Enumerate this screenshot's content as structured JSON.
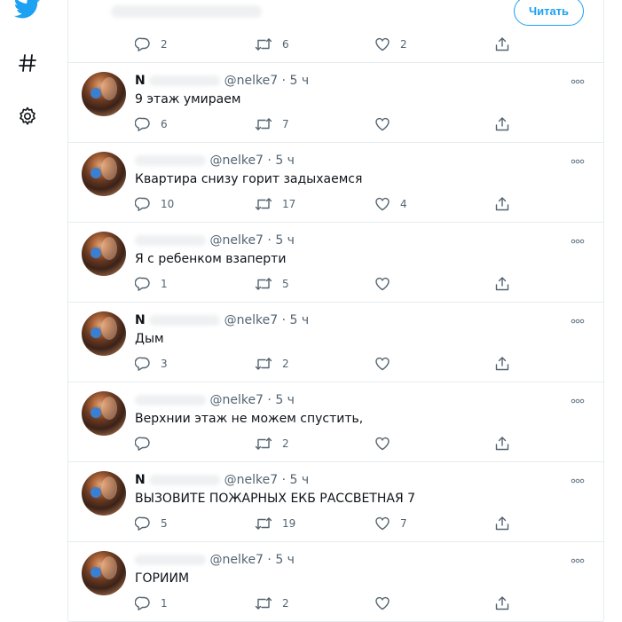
{
  "header": {
    "follow_label": "Читать"
  },
  "top_tweet": {
    "replies": "2",
    "retweets": "6",
    "likes": "2"
  },
  "tweets": [
    {
      "name": "N",
      "handle": "@nelke7",
      "time": "· 5 ч",
      "text": "9 этаж умираем",
      "replies": "6",
      "retweets": "7",
      "likes": ""
    },
    {
      "name": "",
      "handle": "@nelke7",
      "time": "· 5 ч",
      "text": "Квартира снизу горит задыхаемся",
      "replies": "10",
      "retweets": "17",
      "likes": "4"
    },
    {
      "name": "",
      "handle": "@nelke7",
      "time": "· 5 ч",
      "text": "Я с ребенком взаперти",
      "replies": "1",
      "retweets": "5",
      "likes": ""
    },
    {
      "name": "N",
      "handle": "@nelke7",
      "time": "· 5 ч",
      "text": "Дым",
      "replies": "3",
      "retweets": "2",
      "likes": ""
    },
    {
      "name": "",
      "handle": "@nelke7",
      "time": "· 5 ч",
      "text": "Верхнии этаж не можем спустить,",
      "replies": "",
      "retweets": "2",
      "likes": ""
    },
    {
      "name": "N",
      "handle": "@nelke7",
      "time": "· 5 ч",
      "text": "ВЫЗОВИТЕ ПОЖАРНЫХ ЕКБ РАССВЕТНАЯ 7",
      "replies": "5",
      "retweets": "19",
      "likes": "7"
    },
    {
      "name": "",
      "handle": "@nelke7",
      "time": "· 5 ч",
      "text": "ГОРИИМ",
      "replies": "1",
      "retweets": "2",
      "likes": ""
    }
  ],
  "icons": {
    "brand": "twitter-bird-icon",
    "explore": "hashtag-icon",
    "settings": "gear-icon",
    "reply": "comment-icon",
    "retweet": "retweet-icon",
    "like": "heart-icon",
    "share": "share-icon",
    "more": "more-icon"
  },
  "colors": {
    "accent": "#1da1f2",
    "muted": "#536471",
    "border": "#e6ecf0"
  }
}
